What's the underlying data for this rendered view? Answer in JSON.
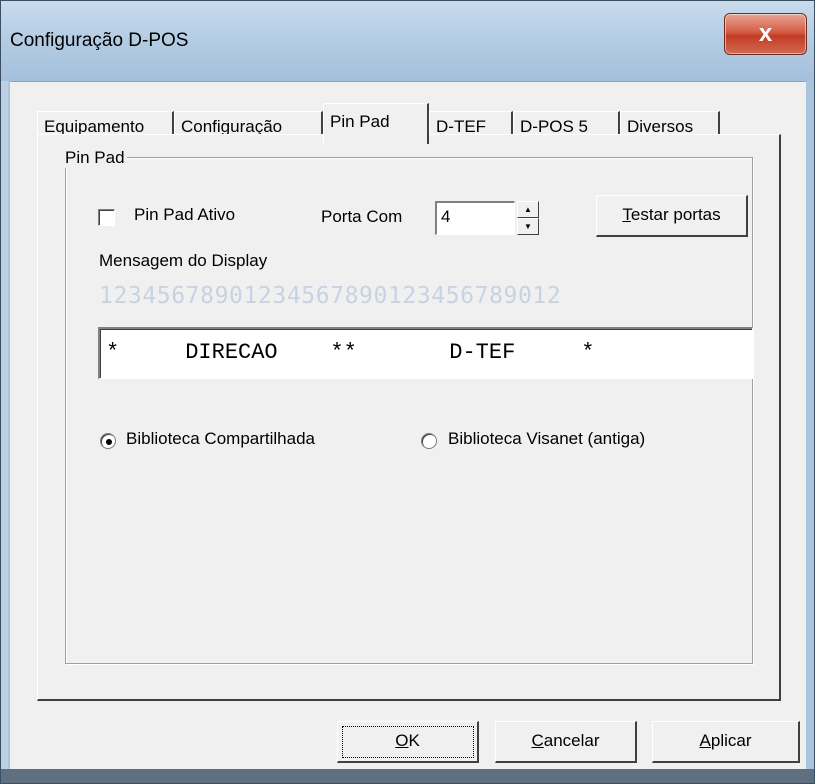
{
  "window": {
    "title": "Configuração D-POS",
    "close_label": "x"
  },
  "tabs": [
    {
      "label": "Equipamento",
      "active": false
    },
    {
      "label": "Configuração",
      "active": false
    },
    {
      "label": "Pin Pad",
      "active": true
    },
    {
      "label": "D-TEF",
      "active": false
    },
    {
      "label": "D-POS 5",
      "active": false
    },
    {
      "label": "Diversos",
      "active": false
    }
  ],
  "pinpad": {
    "group_title": "Pin Pad",
    "ativo_label": "Pin Pad Ativo",
    "ativo_checked": false,
    "porta_label": "Porta Com",
    "porta_value": "4",
    "testar_prefix": "T",
    "testar_rest": "estar portas",
    "mensagem_label": "Mensagem do Display",
    "ruler": "12345678901234567890123456789012",
    "display_text": "*     DIRECAO    **       D-TEF     *",
    "radio_compartilhada": "Biblioteca Compartilhada",
    "radio_visanet": "Biblioteca Visanet (antiga)",
    "selected_library": "Biblioteca Compartilhada"
  },
  "buttons": {
    "ok_prefix": "O",
    "ok_rest": "K",
    "cancelar_prefix": "C",
    "cancelar_rest": "ancelar",
    "aplicar_prefix": "A",
    "aplicar_rest": "plicar"
  },
  "colors": {
    "title_bar": "#b3cce3",
    "close_button": "#c94b33",
    "face": "#f0f0f0",
    "ruler_text": "#c7d3e3"
  },
  "icons": {
    "close": "close-icon",
    "spin_up": "arrow-up-icon",
    "spin_down": "arrow-down-icon"
  }
}
